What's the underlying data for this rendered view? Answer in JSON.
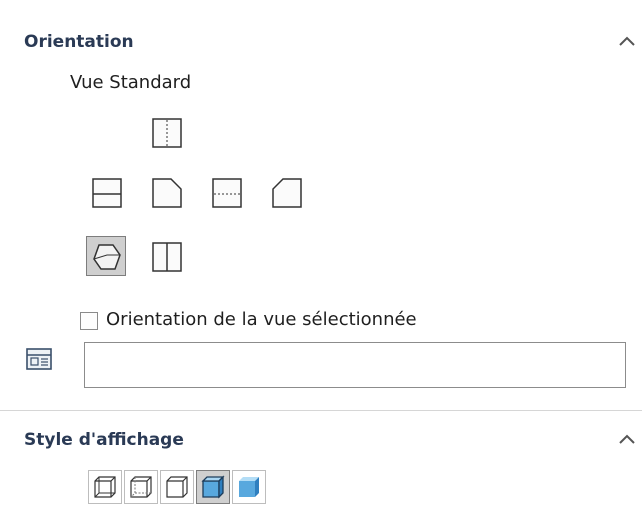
{
  "orientation": {
    "title": "Orientation",
    "standard_views_label": "Vue Standard",
    "views": {
      "top": {
        "icon": "top-view-icon"
      },
      "front": {
        "icon": "front-view-icon"
      },
      "left": {
        "icon": "left-view-icon"
      },
      "bottom": {
        "icon": "bottom-view-icon"
      },
      "right": {
        "icon": "right-view-icon"
      },
      "isometric": {
        "icon": "isometric-view-icon",
        "selected": true
      },
      "back": {
        "icon": "back-view-icon"
      }
    },
    "selected_view_checkbox_label": "Orientation de la vue sélectionnée",
    "selected_view_checkbox_checked": false,
    "named_view_input_value": "",
    "named_view_icon": "view-selector-icon"
  },
  "display_style": {
    "title": "Style d'affichage",
    "styles": [
      {
        "icon": "wireframe-icon"
      },
      {
        "icon": "hidden-lines-visible-icon"
      },
      {
        "icon": "hidden-lines-removed-icon"
      },
      {
        "icon": "shaded-with-edges-icon",
        "selected": true
      },
      {
        "icon": "shaded-icon"
      }
    ]
  },
  "colors": {
    "title": "#2a3a55",
    "shade_blue": "#58a8de",
    "shade_blue_dark": "#2f7fbf",
    "selected_bg": "#cfcfcf"
  }
}
